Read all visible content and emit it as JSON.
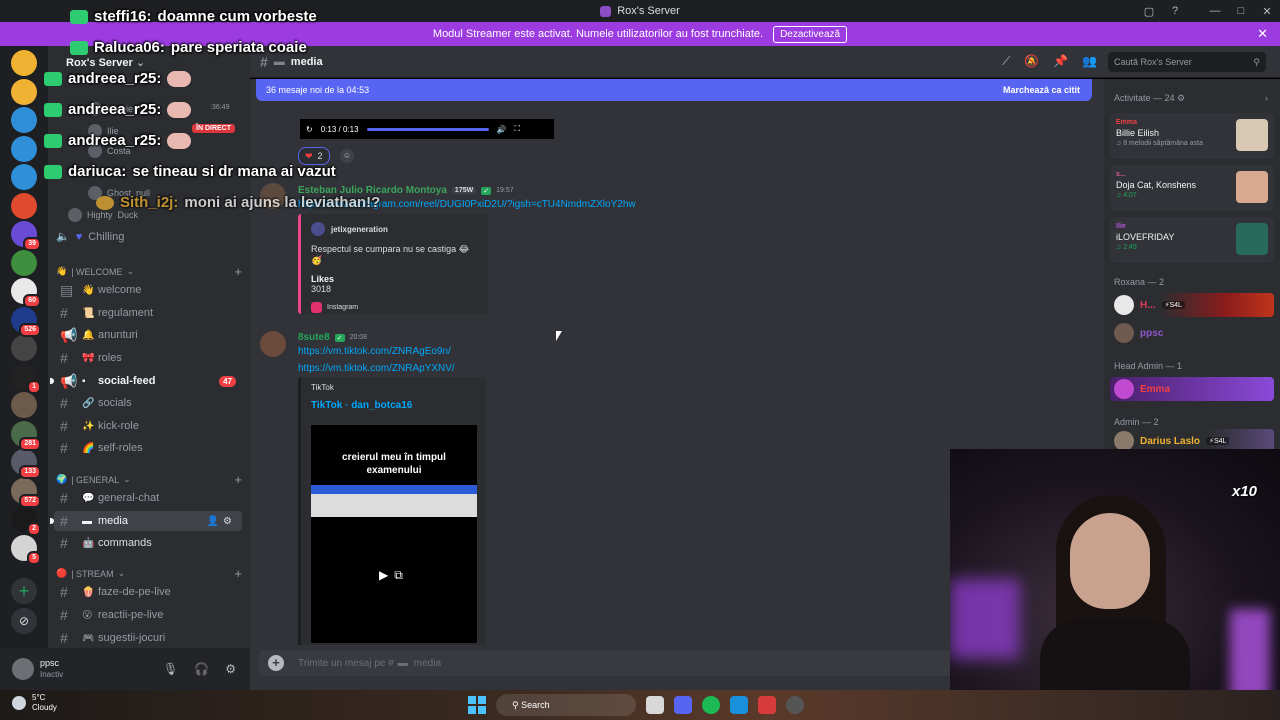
{
  "window": {
    "title": "Rox's Server",
    "controls": [
      "▢",
      "?",
      "—",
      "□",
      "✕"
    ]
  },
  "banner": {
    "text": "Modul Streamer este activat. Numele utilizatorilor au fost trunchiate.",
    "button": "Dezactivează",
    "close": "✕"
  },
  "rail": {
    "servers": [
      {
        "color": "#f0b232",
        "badge": ""
      },
      {
        "color": "#f0b232",
        "badge": ""
      },
      {
        "color": "#2f8fd8",
        "badge": ""
      },
      {
        "color": "#2f8fd8",
        "badge": ""
      },
      {
        "color": "#2f8fd8",
        "badge": ""
      },
      {
        "color": "#e04a2f",
        "badge": ""
      },
      {
        "color": "#6a4bd6",
        "badge": "39"
      },
      {
        "color": "#3e8e3e",
        "badge": ""
      },
      {
        "color": "#e8e8e8",
        "badge": "60"
      },
      {
        "color": "#1f3b8c",
        "badge": "526"
      },
      {
        "color": "#444444",
        "badge": ""
      },
      {
        "color": "#222222",
        "badge": "1"
      },
      {
        "color": "#6c5a4a",
        "badge": ""
      },
      {
        "color": "#4a6b4a",
        "badge": "281"
      },
      {
        "color": "#5a5a6a",
        "badge": "133"
      },
      {
        "color": "#7a6a5a",
        "badge": "572"
      },
      {
        "color": "#1a1a1a",
        "badge": "2"
      },
      {
        "color": "#d4d4d4",
        "badge": "5"
      }
    ],
    "add": "+",
    "explore": "⊘"
  },
  "sidebar": {
    "server_name": "Rox's Server",
    "voice": {
      "time": ":36:49",
      "live": "ÎN DIRECT",
      "users": [
        "Homies",
        "Ilie",
        "Costa",
        "Ghost",
        "Highty"
      ],
      "extra": [
        "null",
        "Duck"
      ]
    },
    "vc_channel": "Chilling",
    "categories": [
      {
        "name": "| WELCOME",
        "icon": "👋"
      },
      {
        "name": "| GENERAL",
        "icon": "🌍"
      },
      {
        "name": "| STREAM",
        "icon": "🔴"
      }
    ],
    "channels": [
      {
        "name": "welcome",
        "emoji": "👋",
        "hash": "▤"
      },
      {
        "name": "regulament",
        "emoji": "📜",
        "hash": "#"
      },
      {
        "name": "anunturi",
        "emoji": "🔔",
        "hash": "📢"
      },
      {
        "name": "roles",
        "emoji": "🎀",
        "hash": "#"
      },
      {
        "name": "social-feed",
        "emoji": "▪",
        "hash": "📢",
        "mention": "47"
      },
      {
        "name": "socials",
        "emoji": "🔗",
        "hash": "#"
      },
      {
        "name": "kick-role",
        "emoji": "✨",
        "hash": "#"
      },
      {
        "name": "self-roles",
        "emoji": "🌈",
        "hash": "#"
      },
      {
        "name": "general-chat",
        "emoji": "💬",
        "hash": "#"
      },
      {
        "name": "media",
        "emoji": "▬",
        "hash": "#",
        "controls": "👤⚙"
      },
      {
        "name": "commands",
        "emoji": "🤖",
        "hash": "#"
      },
      {
        "name": "faze-de-pe-live",
        "emoji": "🍿",
        "hash": "#"
      },
      {
        "name": "reactii-pe-live",
        "emoji": "😮",
        "hash": "#"
      },
      {
        "name": "sugestii-jocuri",
        "emoji": "🎮",
        "hash": "#"
      }
    ],
    "plus": "+"
  },
  "user": {
    "name": "ppsc",
    "status": "Inactiv",
    "controls": [
      "🎙",
      "🎧",
      "⚙"
    ]
  },
  "header": {
    "channel": "media",
    "search_placeholder": "Caută Rox's Server",
    "icons": [
      "⟋",
      "🔕",
      "📌",
      "👥"
    ]
  },
  "chat": {
    "new_messages": "36 mesaje noi de la 04:53",
    "mark_read": "Marchează ca citit",
    "player_time": "0:13 / 0:13",
    "reaction": {
      "emoji": "❤",
      "count": "2"
    },
    "messages": [
      {
        "author": "Esteban Julio Ricardo Montoya",
        "author_color": "#3ba55c",
        "tag": "175W",
        "time": "19:57",
        "link": "https://www.instagram.com/reel/DUGI0PxiD2U/?igsh=cTU4NmdmZXloY2hw",
        "embed": {
          "provider": "jetixgeneration",
          "description": "Respectul se cumpara nu se castiga 😂🥳",
          "field_name": "Likes",
          "field_value": "3018",
          "footer": "Instagram"
        }
      },
      {
        "author": "8sute8",
        "author_color": "#23a55a",
        "time": "20:08",
        "links": [
          "https://vm.tiktok.com/ZNRAgEo9n/",
          "https://vm.tiktok.com/ZNRApYXNV/"
        ],
        "embed": {
          "provider": "TikTok",
          "title": "TikTok · dan_botca16",
          "video_caption_1": "creierul meu în timpul",
          "video_caption_2": "examenului"
        }
      }
    ],
    "input_placeholder": "Trimite un mesaj pe #",
    "input_channel": "media"
  },
  "members": {
    "activity_header": "Activitate — 24",
    "activities": [
      {
        "user": "Emma",
        "user_color": "#f23f43",
        "title": "Billie Eilish",
        "sub": "8 melodii săptămâna asta",
        "sub_green": false,
        "thumb": "#d9c8b4"
      },
      {
        "user": "s...",
        "user_color": "#e05a9b",
        "title": "Doja Cat, Konshens",
        "sub": "4:07",
        "sub_green": true,
        "thumb": "#d8a890"
      },
      {
        "user": "Ilie",
        "user_color": "#b05ad8",
        "title": "iLOVEFRIDAY",
        "sub": "2:49",
        "sub_green": true,
        "thumb": "#2a6a5a"
      }
    ],
    "roles": [
      {
        "name": "Roxana — 2"
      },
      {
        "name": "Head Admin — 1"
      },
      {
        "name": "Admin — 2"
      }
    ],
    "people": [
      {
        "name": "H...",
        "color": "#e03a5a",
        "tag": "⚡S4L",
        "bg": "linear-gradient(90deg,#2b2d31 30%,#8a1c1c 70%,#c0351c)"
      },
      {
        "name": "ppsc",
        "color": "#8e56c9",
        "tag": "",
        "bg": "transparent"
      },
      {
        "name": "Emma",
        "color": "#f23f43",
        "tag": "",
        "bg": "linear-gradient(90deg,#4a1f6a,#8a4ad8)"
      },
      {
        "name": "Darius Laslo",
        "color": "#f0b232",
        "tag": "⚡S4L",
        "bg": "linear-gradient(90deg,#2b2d31 60%,#5a4a7a)"
      }
    ]
  },
  "taskbar": {
    "temp": "5°C",
    "weather": "Cloudy",
    "search": "Search"
  },
  "overlay": {
    "lines": [
      {
        "user": "steffi16:",
        "msg": "doamne cum vorbeste",
        "icon": "#2ecc71"
      },
      {
        "user": "Raluca06:",
        "msg": "pare speriata coaie",
        "icon": "#2ecc71"
      },
      {
        "user": "andreea_r25:",
        "msg": "",
        "icon": "#2ecc71",
        "emote": true
      },
      {
        "user": "andreea_r25:",
        "msg": "",
        "icon": "#2ecc71",
        "emote": true
      },
      {
        "user": "andreea_r25:",
        "msg": "",
        "icon": "#2ecc71",
        "emote": true
      },
      {
        "user": "dariuca:",
        "msg": "se tineau si dr mana ai vazut",
        "icon": "#2ecc71"
      },
      {
        "user": "Sith_i2j:",
        "msg": "moni ai ajuns la leviathan!?",
        "icon": "#f0b232"
      }
    ]
  },
  "webcam": {
    "multiplier": "x10"
  }
}
